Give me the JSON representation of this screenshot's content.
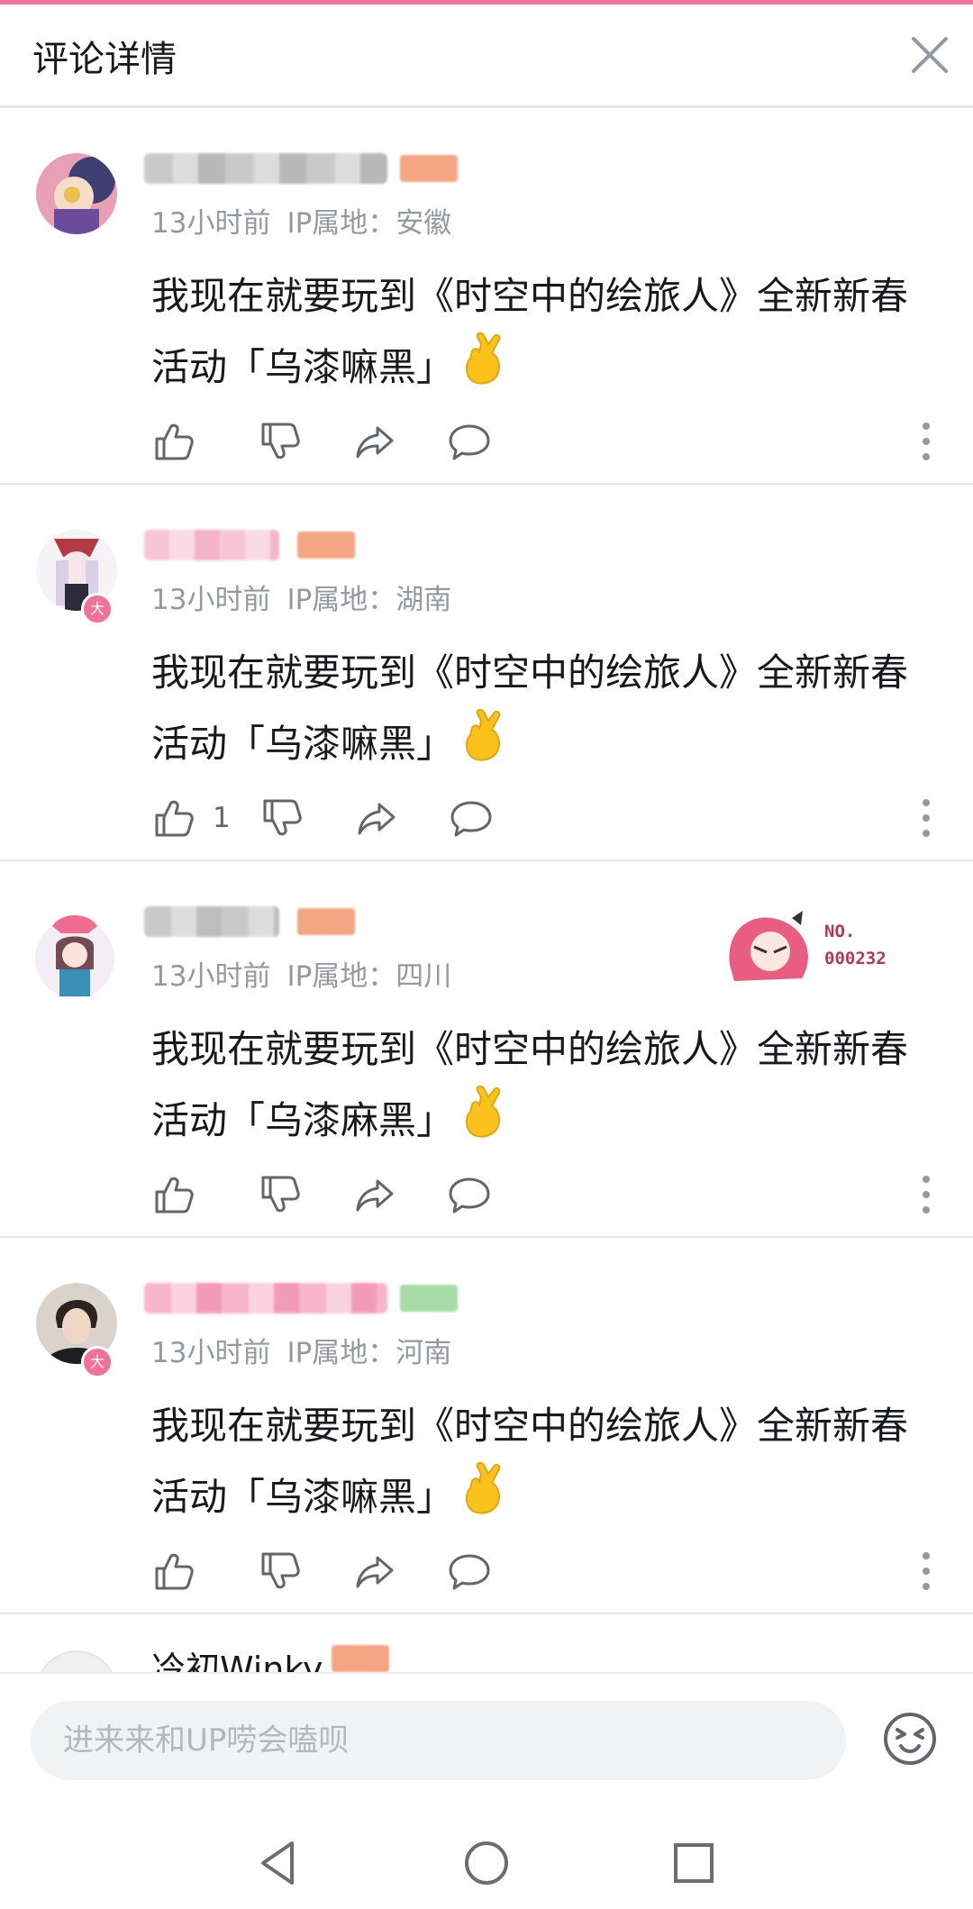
{
  "header": {
    "title": "评论详情"
  },
  "comments": [
    {
      "time": "13小时前",
      "ip": "IP属地：安徽",
      "line1": "我现在就要玩到《时空中的绘旅人》全新新春",
      "line2": "活动「乌漆嘛黑」",
      "likes": ""
    },
    {
      "time": "13小时前",
      "ip": "IP属地：湖南",
      "line1": "我现在就要玩到《时空中的绘旅人》全新新春",
      "line2": "活动「乌漆嘛黑」",
      "likes": "1"
    },
    {
      "time": "13小时前",
      "ip": "IP属地：四川",
      "line1": "我现在就要玩到《时空中的绘旅人》全新新春",
      "line2": "活动「乌漆麻黑」",
      "likes": "",
      "pendant": "NO.\n000232"
    },
    {
      "time": "13小时前",
      "ip": "IP属地：河南",
      "line1": "我现在就要玩到《时空中的绘旅人》全新新春",
      "line2": "活动「乌漆嘛黑」",
      "likes": ""
    }
  ],
  "partial_comment": {
    "name": "冷初Winky"
  },
  "badge": {
    "level_text": "大"
  },
  "input": {
    "placeholder": "进来来和UP唠会嗑呗"
  },
  "icons": [
    "close-icon",
    "like-icon",
    "dislike-icon",
    "share-icon",
    "reply-icon",
    "more-icon",
    "emoji-icon",
    "back-icon",
    "home-icon",
    "recents-icon",
    "fingers-crossed-emoji"
  ],
  "colors": {
    "accent": "#f0719a",
    "meta": "#9499a0",
    "icon": "#61666d",
    "emoji": "#fcc21b"
  }
}
